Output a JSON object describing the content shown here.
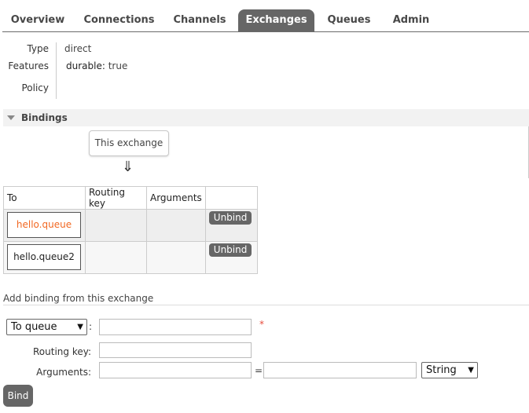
{
  "nav": {
    "tabs": [
      {
        "label": "Overview"
      },
      {
        "label": "Connections"
      },
      {
        "label": "Channels"
      },
      {
        "label": "Exchanges",
        "active": true
      },
      {
        "label": "Queues"
      },
      {
        "label": "Admin"
      }
    ]
  },
  "details": {
    "type_label": "Type",
    "type_value": "direct",
    "features_label": "Features",
    "durable_key": "durable:",
    "durable_value": "true",
    "policy_label": "Policy"
  },
  "bindings": {
    "section_title": "Bindings",
    "this_exchange": "This exchange",
    "arrow": "⇓",
    "headers": [
      "To",
      "Routing key",
      "Arguments",
      ""
    ],
    "rows": [
      {
        "to": "hello.queue",
        "routing_key": "",
        "arguments": "",
        "action": "Unbind"
      },
      {
        "to": "hello.queue2",
        "routing_key": "",
        "arguments": "",
        "action": "Unbind"
      }
    ]
  },
  "add_binding": {
    "title": "Add binding from this exchange",
    "destination_type": "To queue",
    "colon": ":",
    "required_mark": "*",
    "routing_key_label": "Routing key:",
    "arguments_label": "Arguments:",
    "equals": "=",
    "arg_type": "String",
    "bind_label": "Bind"
  },
  "colors": {
    "accent_orange": "#f26822",
    "tab_active_bg": "#666666",
    "button_bg": "#666666"
  }
}
